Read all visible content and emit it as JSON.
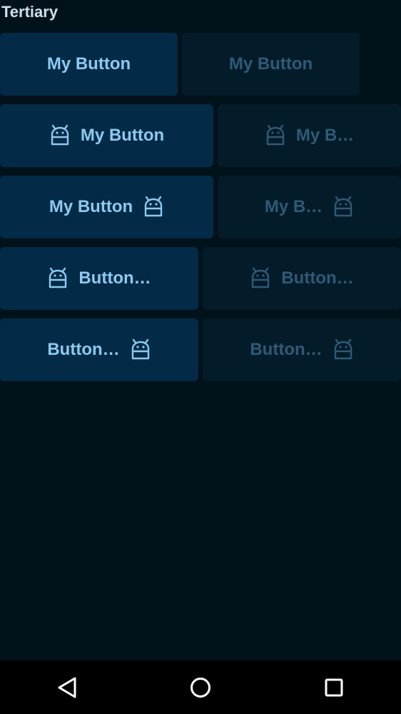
{
  "section": {
    "title": "Tertiary"
  },
  "rows": [
    {
      "enabled": {
        "label": "My Button",
        "icon": "android-icon",
        "icon_position": "none"
      },
      "disabled": {
        "label": "My Button",
        "icon": "android-icon",
        "icon_position": "none"
      }
    },
    {
      "enabled": {
        "label": "My Button",
        "icon": "android-icon",
        "icon_position": "start"
      },
      "disabled": {
        "label": "My B…",
        "icon": "android-icon",
        "icon_position": "start"
      }
    },
    {
      "enabled": {
        "label": "My Button",
        "icon": "android-icon",
        "icon_position": "end"
      },
      "disabled": {
        "label": "My B…",
        "icon": "android-icon",
        "icon_position": "end"
      }
    },
    {
      "enabled": {
        "label": "Button…",
        "icon": "android-icon",
        "icon_position": "start"
      },
      "disabled": {
        "label": "Button…",
        "icon": "android-icon",
        "icon_position": "start"
      }
    },
    {
      "enabled": {
        "label": "Button…",
        "icon": "android-icon",
        "icon_position": "end"
      },
      "disabled": {
        "label": "Button…",
        "icon": "android-icon",
        "icon_position": "end"
      }
    }
  ],
  "colors": {
    "background": "#02121b",
    "button_enabled_bg": "#032a46",
    "button_enabled_text": "#8ec9ef",
    "button_disabled_bg": "#041b29",
    "button_disabled_text": "#2f5a76",
    "title_text": "#cfe0ea"
  },
  "navbar": {
    "back": "back-triangle-icon",
    "home": "home-circle-icon",
    "recents": "recents-square-icon"
  }
}
